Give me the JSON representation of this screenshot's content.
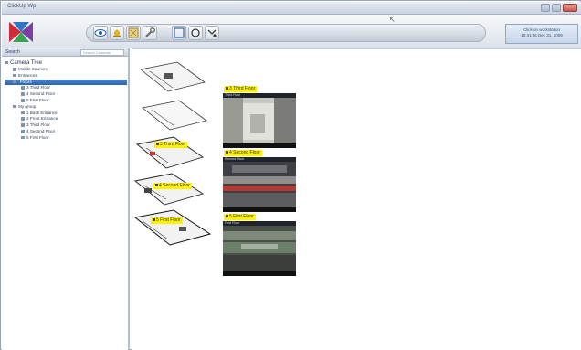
{
  "window": {
    "title": "ClickUp Wp"
  },
  "toolbar": {
    "status_line1": "Click on workstation",
    "status_line2": "10:41:46 Dec 31, 2009"
  },
  "left_panel": {
    "header_label": "Search",
    "search_placeholder": "Search Cameras",
    "tree": [
      {
        "label": "Camera Tree",
        "level": 0,
        "root": true
      },
      {
        "label": "Mobile Sources",
        "level": 1
      },
      {
        "label": "Entrances",
        "level": 1
      },
      {
        "label": "Floors",
        "level": 1,
        "selected": true
      },
      {
        "label": "3 Third Floor",
        "level": 2
      },
      {
        "label": "4 Second Floor",
        "level": 2
      },
      {
        "label": "5 First Floor",
        "level": 2
      },
      {
        "label": "My group",
        "level": 1
      },
      {
        "label": "1 Back Entrance",
        "level": 2
      },
      {
        "label": "2 Front Entrance",
        "level": 2
      },
      {
        "label": "3 Third Floor",
        "level": 2
      },
      {
        "label": "4 Second Floor",
        "level": 2
      },
      {
        "label": "5 First Floor",
        "level": 2
      }
    ]
  },
  "main": {
    "floor_tags": [
      {
        "label": "3 Third Floor"
      },
      {
        "label": "4 Second Floor"
      },
      {
        "label": "5 First Floor"
      }
    ],
    "cameras": [
      {
        "tag": "3 Third Floor",
        "header": "Third Floor"
      },
      {
        "tag": "4 Second Floor",
        "header": "Second Floor"
      },
      {
        "tag": "5 First Floor",
        "header": "First Floor"
      }
    ]
  }
}
